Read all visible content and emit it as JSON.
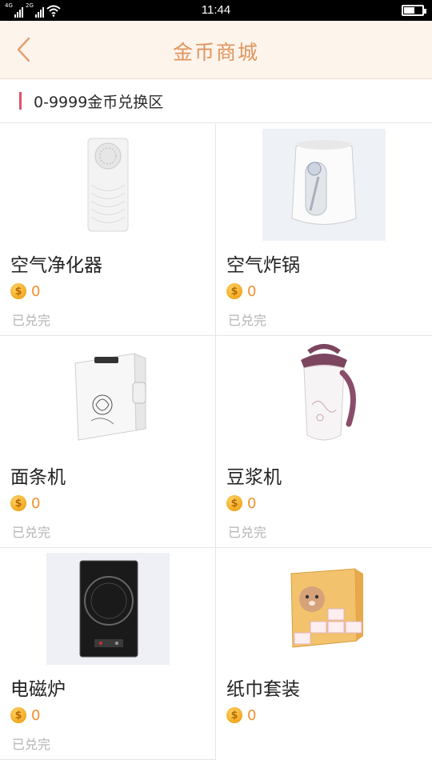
{
  "status_bar": {
    "network_1": "4G",
    "network_2": "2G",
    "time": "11:44",
    "battery_level": 0.55
  },
  "header": {
    "title": "金币商城",
    "back_icon": "chevron-left-icon"
  },
  "section": {
    "label": "0-9999金币兑换区"
  },
  "colors": {
    "header_bg": "#fdf4ec",
    "title": "#e0955d",
    "section_marker": "#e3506b",
    "price": "#f0912a",
    "status": "#b4b4b4"
  },
  "products": [
    {
      "name": "空气净化器",
      "price": "0",
      "status": "已兑完",
      "icon": "air-purifier-image"
    },
    {
      "name": "空气炸锅",
      "price": "0",
      "status": "已兑完",
      "icon": "air-fryer-image"
    },
    {
      "name": "面条机",
      "price": "0",
      "status": "已兑完",
      "icon": "noodle-machine-image"
    },
    {
      "name": "豆浆机",
      "price": "0",
      "status": "已兑完",
      "icon": "soymilk-maker-image"
    },
    {
      "name": "电磁炉",
      "price": "0",
      "status": "已兑完",
      "icon": "induction-cooker-image"
    },
    {
      "name": "纸巾套装",
      "price": "0",
      "status": "",
      "icon": "tissue-set-image"
    }
  ]
}
